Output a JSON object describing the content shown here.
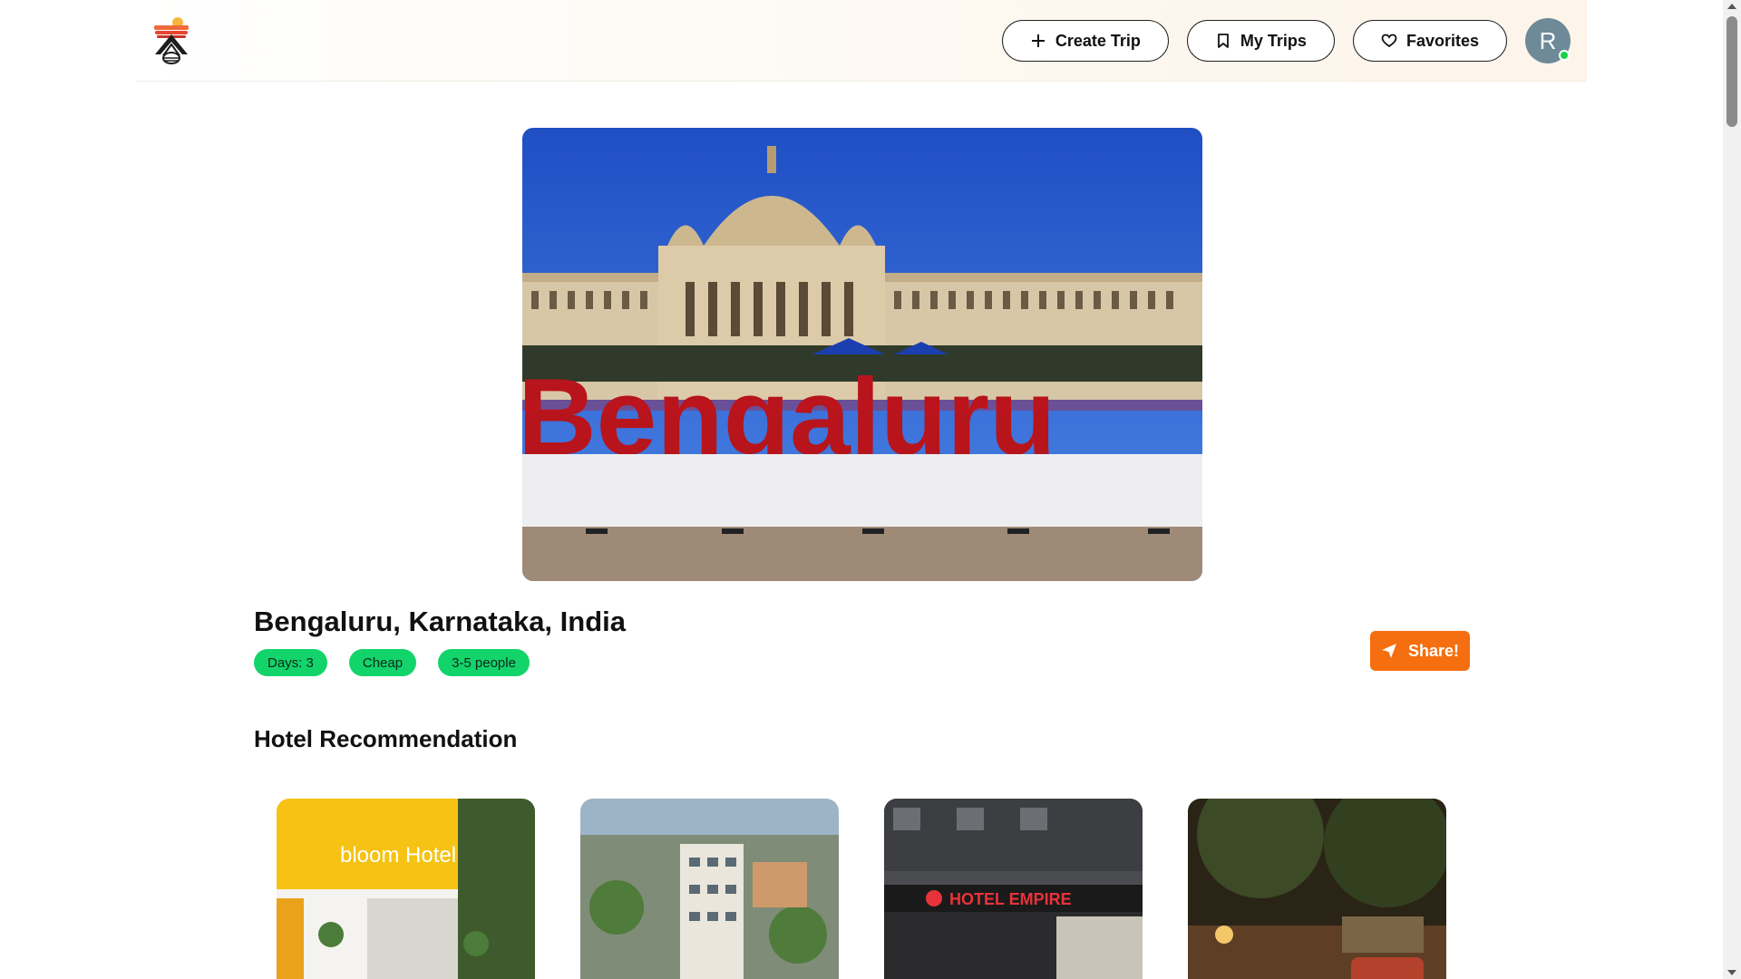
{
  "header": {
    "logo_name": "travel-logo",
    "nav": {
      "create_trip": "Create Trip",
      "my_trips": "My Trips",
      "favorites": "Favorites"
    },
    "avatar_initial": "R"
  },
  "hero": {
    "sign_text": "Bengaluru"
  },
  "trip": {
    "title": "Bengaluru, Karnataka, India",
    "badges": [
      "Days: 3",
      "Cheap",
      "3-5 people"
    ],
    "share_label": "Share!"
  },
  "hotels": {
    "section_title": "Hotel Recommendation",
    "cards": [
      {
        "sign": "bloom Hotel"
      },
      {
        "sign": ""
      },
      {
        "sign": "HOTEL EMPIRE"
      },
      {
        "sign": ""
      }
    ]
  },
  "colors": {
    "accent_orange": "#f56e0f",
    "badge_green": "#13d36b",
    "online_green": "#16d14a"
  }
}
